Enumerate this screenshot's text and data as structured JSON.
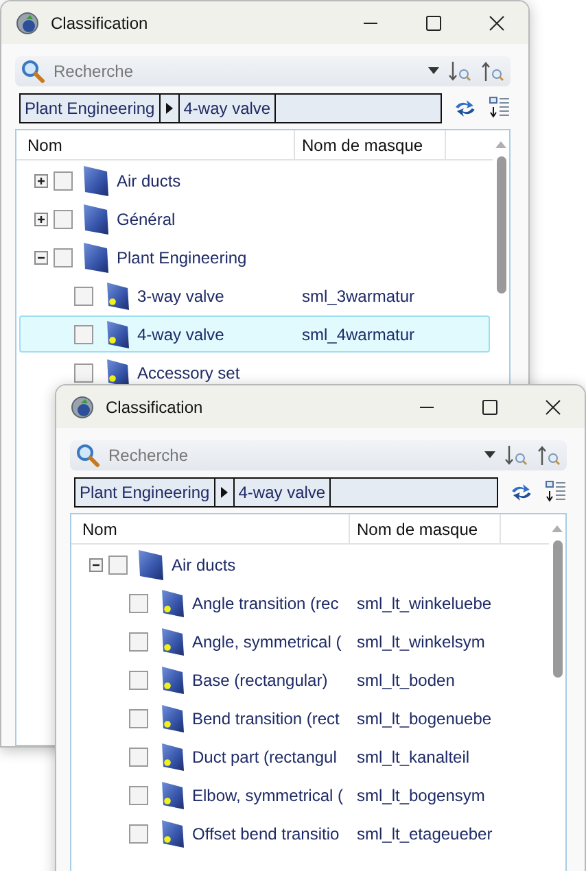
{
  "windows": [
    {
      "title": "Classification",
      "search": {
        "placeholder": "Recherche"
      },
      "breadcrumb": [
        "Plant Engineering",
        "4-way valve"
      ],
      "columns": [
        "Nom",
        "Nom de masque"
      ],
      "tree": [
        {
          "kind": "group",
          "name": "Air ducts",
          "expanded": false,
          "checked": false,
          "selected": false
        },
        {
          "kind": "group",
          "name": "Général",
          "expanded": false,
          "checked": false,
          "selected": false
        },
        {
          "kind": "group",
          "name": "Plant Engineering",
          "expanded": true,
          "checked": false,
          "selected": false,
          "children": [
            {
              "kind": "item",
              "name": "3-way valve",
              "mask": "sml_3warmatur",
              "checked": false,
              "selected": false
            },
            {
              "kind": "item",
              "name": "4-way valve",
              "mask": "sml_4warmatur",
              "checked": false,
              "selected": true
            },
            {
              "kind": "item",
              "name": "Accessory set",
              "checked": false,
              "selected": false
            }
          ]
        }
      ]
    },
    {
      "title": "Classification",
      "search": {
        "placeholder": "Recherche"
      },
      "breadcrumb": [
        "Plant Engineering",
        "4-way valve"
      ],
      "columns": [
        "Nom",
        "Nom de masque"
      ],
      "tree": [
        {
          "kind": "group",
          "name": "Air ducts",
          "expanded": true,
          "checked": false,
          "selected": false,
          "children": [
            {
              "kind": "item",
              "name": "Angle transition (rec",
              "mask": "sml_lt_winkeluebe",
              "checked": false,
              "selected": false
            },
            {
              "kind": "item",
              "name": "Angle, symmetrical (",
              "mask": "sml_lt_winkelsym",
              "checked": false,
              "selected": false
            },
            {
              "kind": "item",
              "name": "Base (rectangular)",
              "mask": "sml_lt_boden",
              "checked": false,
              "selected": false
            },
            {
              "kind": "item",
              "name": "Bend transition (rect",
              "mask": "sml_lt_bogenuebe",
              "checked": false,
              "selected": false
            },
            {
              "kind": "item",
              "name": "Duct part (rectangul",
              "mask": "sml_lt_kanalteil",
              "checked": false,
              "selected": false
            },
            {
              "kind": "item",
              "name": "Elbow, symmetrical (",
              "mask": "sml_lt_bogensym",
              "checked": false,
              "selected": false
            },
            {
              "kind": "item",
              "name": "Offset bend transitio",
              "mask": "sml_lt_etageueber",
              "checked": false,
              "selected": false
            }
          ]
        }
      ]
    }
  ]
}
